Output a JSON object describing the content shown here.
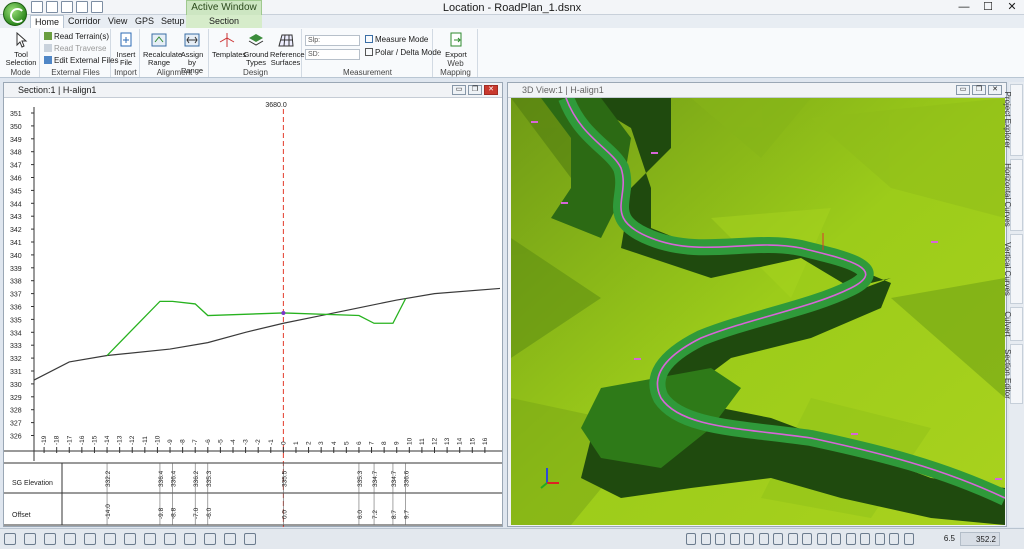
{
  "window": {
    "title": "Location - RoadPlan_1.dsnx",
    "context_tab": "Active Window",
    "minimize": "—",
    "maximize": "☐",
    "close": "✕"
  },
  "tabs": [
    {
      "label": "Home",
      "active": true
    },
    {
      "label": "Corridor"
    },
    {
      "label": "View"
    },
    {
      "label": "GPS"
    },
    {
      "label": "Setup"
    },
    {
      "label": "Section"
    }
  ],
  "ribbon": {
    "mode": {
      "group": "Mode",
      "tool_selection": "Tool Selection"
    },
    "external_files": {
      "group": "External Files",
      "read_terrain": "Read Terrain(s)",
      "read_traverse": "Read Traverse",
      "edit_external": "Edit External Files"
    },
    "import": {
      "group": "Import",
      "insert_file": "Insert File"
    },
    "alignment": {
      "group": "Alignment",
      "recalculate": "Recalculate Range",
      "assign": "Assign by Range"
    },
    "design": {
      "group": "Design",
      "templates": "Templates",
      "ground_types": "Ground Types",
      "reference_surfaces": "Reference Surfaces"
    },
    "measurement": {
      "group": "Measurement",
      "slp_label": "Slp:",
      "sd_label": "SD:",
      "measure_mode": "Measure Mode",
      "polar_delta": "Polar / Delta Mode"
    },
    "web_mapping": {
      "group": "Web Mapping",
      "export": "Export"
    }
  },
  "section_view": {
    "title": "Section:1 | H-align1",
    "station": "3680.0",
    "y_labels": [
      "351",
      "350",
      "349",
      "348",
      "347",
      "346",
      "345",
      "344",
      "343",
      "342",
      "341",
      "340",
      "339",
      "338",
      "337",
      "336",
      "335",
      "334",
      "333",
      "332",
      "331",
      "330",
      "329",
      "328",
      "327",
      "326"
    ],
    "x_labels": [
      "-19",
      "-18",
      "-17",
      "-16",
      "-15",
      "-14",
      "-13",
      "-12",
      "-11",
      "-10",
      "-9",
      "-8",
      "-7",
      "-6",
      "-5",
      "-4",
      "-3",
      "-2",
      "-1",
      "0",
      "1",
      "2",
      "3",
      "4",
      "5",
      "6",
      "7",
      "8",
      "9",
      "10",
      "11",
      "12",
      "13",
      "14",
      "15",
      "16"
    ],
    "row_labels": {
      "sg_elevation": "SG Elevation",
      "offset": "Offset"
    },
    "sg_elevation": [
      "332.2",
      "336.4",
      "336.4",
      "336.2",
      "335.3",
      "335.5",
      "335.3",
      "334.7",
      "334.7",
      "336.6"
    ],
    "offsets": [
      "-14.0",
      "-9.8",
      "-8.8",
      "-7.0",
      "-6.0",
      "0.0",
      "6.0",
      "7.2",
      "8.7",
      "9.7"
    ]
  },
  "view3d": {
    "title": "3D View:1 | H-align1"
  },
  "side_tabs": [
    "Project Explorer",
    "Horizontal Curves",
    "Vertical Curves",
    "Culvert",
    "Section Editor"
  ],
  "status": {
    "zoom_value": "6.5",
    "elevation_value": "352.2"
  },
  "colors": {
    "terrain_light": "#9ccc1a",
    "terrain_dark": "#3d6a12",
    "road": "#2f9a3a",
    "centerline": "#d766d9",
    "template_line": "#27b21f",
    "ground_line": "#3a3a3a",
    "station_line": "#e23b2b"
  }
}
